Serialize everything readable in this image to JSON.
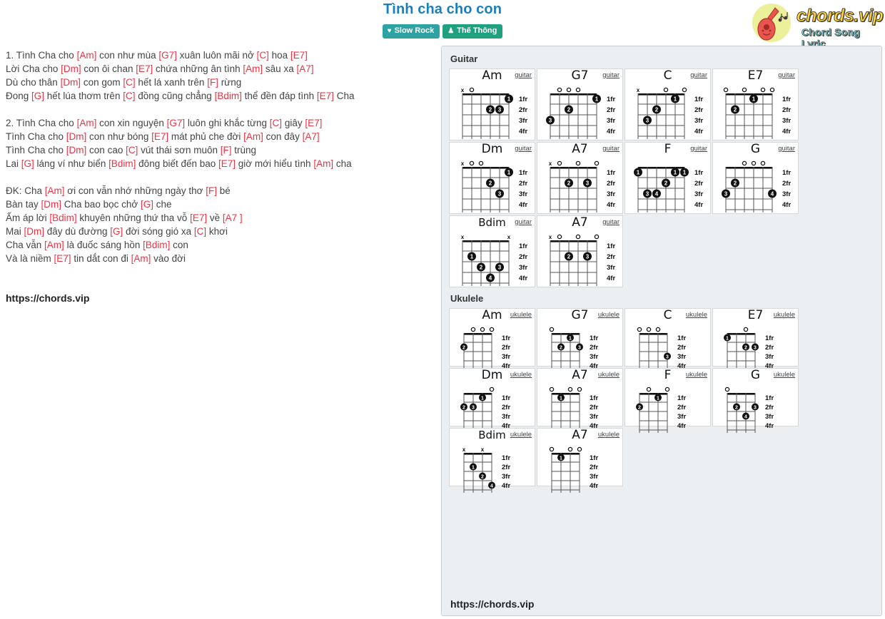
{
  "header": {
    "title": "Tình cha cho con",
    "badges": [
      {
        "name": "rhythm-badge",
        "icon": "heartbeat-icon",
        "glyph": "♥",
        "label": "Slow Rock",
        "color": "#2fa3a3"
      },
      {
        "name": "author-badge",
        "icon": "user-icon",
        "glyph": "♟",
        "label": "Thế Thông",
        "color": "#1fa07e"
      }
    ],
    "logo": {
      "brand": "chords.vip",
      "tagline": "Chord Song Lyric",
      "circle_color": "#ecf09a",
      "guitar_color": "#e8544e",
      "brand_color": "#ffd83d",
      "tagline_color": "#6fd5e3"
    }
  },
  "lyrics": {
    "chord_color": "#ee3344",
    "lines": [
      [
        {
          "t": "1. Tình Cha cho "
        },
        {
          "c": "[Am]"
        },
        {
          "t": " con như mùa "
        },
        {
          "c": "[G7]"
        },
        {
          "t": " xuân luôn mãi nở "
        },
        {
          "c": "[C]"
        },
        {
          "t": " hoa "
        },
        {
          "c": "[E7]"
        }
      ],
      [
        {
          "t": "Lời Cha cho "
        },
        {
          "c": "[Dm]"
        },
        {
          "t": " con ôi chan "
        },
        {
          "c": "[E7]"
        },
        {
          "t": " chứa những ân tình "
        },
        {
          "c": "[Am]"
        },
        {
          "t": " sâu xa "
        },
        {
          "c": "[A7]"
        }
      ],
      [
        {
          "t": "Dù cho thân "
        },
        {
          "c": "[Dm]"
        },
        {
          "t": " con gom "
        },
        {
          "c": "[C]"
        },
        {
          "t": " hết lá xanh trên "
        },
        {
          "c": "[F]"
        },
        {
          "t": " rừng"
        }
      ],
      [
        {
          "t": "Đong "
        },
        {
          "c": "[G]"
        },
        {
          "t": " hết lúa thơm trên "
        },
        {
          "c": "[C]"
        },
        {
          "t": " đồng cũng chẳng "
        },
        {
          "c": "[Bdim]"
        },
        {
          "t": " thể đền đáp tình "
        },
        {
          "c": "[E7]"
        },
        {
          "t": " Cha"
        }
      ],
      [],
      [
        {
          "t": "2. Tình Cha cho "
        },
        {
          "c": "[Am]"
        },
        {
          "t": " con xin nguyện "
        },
        {
          "c": "[G7]"
        },
        {
          "t": " luôn ghi khắc từng "
        },
        {
          "c": "[C]"
        },
        {
          "t": " giây "
        },
        {
          "c": "[E7]"
        }
      ],
      [
        {
          "t": "Tình Cha cho "
        },
        {
          "c": "[Dm]"
        },
        {
          "t": " con như bóng "
        },
        {
          "c": "[E7]"
        },
        {
          "t": " mát phủ che đời "
        },
        {
          "c": "[Am]"
        },
        {
          "t": " con đây "
        },
        {
          "c": "[A7]"
        }
      ],
      [
        {
          "t": "Tình Cha cho "
        },
        {
          "c": "[Dm]"
        },
        {
          "t": " con cao "
        },
        {
          "c": "[C]"
        },
        {
          "t": " vút thái sơn muôn "
        },
        {
          "c": "[F]"
        },
        {
          "t": " trùng"
        }
      ],
      [
        {
          "t": "Lai "
        },
        {
          "c": "[G]"
        },
        {
          "t": " láng ví như biển "
        },
        {
          "c": "[Bdim]"
        },
        {
          "t": " đông biết đến bao "
        },
        {
          "c": "[E7]"
        },
        {
          "t": " giờ mới hiểu tình "
        },
        {
          "c": "[Am]"
        },
        {
          "t": " cha"
        }
      ],
      [],
      [
        {
          "t": "ĐK: Cha "
        },
        {
          "c": "[Am]"
        },
        {
          "t": " ơi con vẫn nhớ những ngày thơ "
        },
        {
          "c": "[F]"
        },
        {
          "t": " bé"
        }
      ],
      [
        {
          "t": "Bàn tay "
        },
        {
          "c": "[Dm]"
        },
        {
          "t": " Cha bao bọc chở "
        },
        {
          "c": "[G]"
        },
        {
          "t": " che"
        }
      ],
      [
        {
          "t": "Ấm áp lời "
        },
        {
          "c": "[Bdim]"
        },
        {
          "t": " khuyên những thứ tha vỗ "
        },
        {
          "c": "[E7]"
        },
        {
          "t": " về "
        },
        {
          "c": "[A7 ]"
        }
      ],
      [
        {
          "t": "Mai "
        },
        {
          "c": "[Dm]"
        },
        {
          "t": " đây dù đường "
        },
        {
          "c": "[G]"
        },
        {
          "t": " đời sóng gió xa "
        },
        {
          "c": "[C]"
        },
        {
          "t": " khơi"
        }
      ],
      [
        {
          "t": "Cha vẫn "
        },
        {
          "c": "[Am]"
        },
        {
          "t": " là đuốc sáng hồn "
        },
        {
          "c": "[Bdim]"
        },
        {
          "t": " con"
        }
      ],
      [
        {
          "t": "Và là niềm "
        },
        {
          "c": "[E7]"
        },
        {
          "t": " tin dắt con đi "
        },
        {
          "c": "[Am]"
        },
        {
          "t": " vào đời"
        }
      ]
    ],
    "url": "https://chords.vip"
  },
  "panel": {
    "guitar_label": "Guitar",
    "ukulele_label": "Ukulele",
    "fret_labels": [
      "1fr",
      "2fr",
      "3fr",
      "4fr"
    ],
    "instrument_guitar": "guitar",
    "instrument_ukulele": "ukulele",
    "url": "https://chords.vip",
    "guitar_chords": [
      {
        "name": "Am",
        "open": [
          "x",
          "o",
          "",
          "",
          "",
          ""
        ],
        "dots": [
          {
            "s": 5,
            "f": 1,
            "n": "1"
          },
          {
            "s": 3,
            "f": 2,
            "n": "2"
          },
          {
            "s": 4,
            "f": 2,
            "n": "3"
          }
        ]
      },
      {
        "name": "G7",
        "open": [
          "",
          "o",
          "o",
          "o",
          ""
        ],
        "dots": [
          {
            "s": 5,
            "f": 1,
            "n": "1"
          },
          {
            "s": 2,
            "f": 2,
            "n": "2"
          },
          {
            "s": 0,
            "f": 3,
            "n": "3"
          }
        ]
      },
      {
        "name": "C",
        "open": [
          "x",
          "",
          "",
          "o",
          "",
          "o"
        ],
        "dots": [
          {
            "s": 4,
            "f": 1,
            "n": "1"
          },
          {
            "s": 2,
            "f": 2,
            "n": "2"
          },
          {
            "s": 1,
            "f": 3,
            "n": "3"
          }
        ]
      },
      {
        "name": "E7",
        "open": [
          "o",
          "",
          "o",
          "",
          "o",
          "o"
        ],
        "dots": [
          {
            "s": 3,
            "f": 1,
            "n": "1"
          },
          {
            "s": 1,
            "f": 2,
            "n": "2"
          }
        ]
      },
      {
        "name": "Dm",
        "open": [
          "x",
          "o",
          "o",
          "",
          "",
          ""
        ],
        "dots": [
          {
            "s": 5,
            "f": 1,
            "n": "1"
          },
          {
            "s": 3,
            "f": 2,
            "n": "2"
          },
          {
            "s": 4,
            "f": 3,
            "n": "3"
          }
        ]
      },
      {
        "name": "A7",
        "open": [
          "x",
          "o",
          "",
          "o",
          "",
          "o"
        ],
        "dots": [
          {
            "s": 2,
            "f": 2,
            "n": "2"
          },
          {
            "s": 4,
            "f": 2,
            "n": "3"
          }
        ]
      },
      {
        "name": "F",
        "open": [
          "",
          "",
          "",
          "",
          "",
          ""
        ],
        "dots": [
          {
            "s": 0,
            "f": 1,
            "n": "1"
          },
          {
            "s": 4,
            "f": 1,
            "n": "1"
          },
          {
            "s": 5,
            "f": 1,
            "n": "1"
          },
          {
            "s": 3,
            "f": 2,
            "n": "2"
          },
          {
            "s": 1,
            "f": 3,
            "n": "3"
          },
          {
            "s": 2,
            "f": 3,
            "n": "4"
          }
        ]
      },
      {
        "name": "G",
        "open": [
          "",
          "",
          "o",
          "o",
          "o",
          ""
        ],
        "dots": [
          {
            "s": 1,
            "f": 2,
            "n": "2"
          },
          {
            "s": 0,
            "f": 3,
            "n": "3"
          },
          {
            "s": 5,
            "f": 3,
            "n": "4"
          }
        ]
      },
      {
        "name": "Bdim",
        "open": [
          "x",
          "",
          "",
          "",
          "",
          "x"
        ],
        "dots": [
          {
            "s": 1,
            "f": 2,
            "n": "1"
          },
          {
            "s": 2,
            "f": 3,
            "n": "2"
          },
          {
            "s": 4,
            "f": 3,
            "n": "3"
          },
          {
            "s": 3,
            "f": 4,
            "n": "4"
          }
        ]
      },
      {
        "name": "A7",
        "open": [
          "x",
          "o",
          "",
          "o",
          "",
          "o"
        ],
        "dots": [
          {
            "s": 2,
            "f": 2,
            "n": "2"
          },
          {
            "s": 4,
            "f": 2,
            "n": "3"
          }
        ]
      }
    ],
    "ukulele_chords": [
      {
        "name": "Am",
        "open": [
          "",
          "o",
          "o",
          "o"
        ],
        "dots": [
          {
            "s": 0,
            "f": 2,
            "n": "2"
          }
        ]
      },
      {
        "name": "G7",
        "open": [
          "o",
          "",
          "",
          ""
        ],
        "dots": [
          {
            "s": 2,
            "f": 1,
            "n": "1"
          },
          {
            "s": 1,
            "f": 2,
            "n": "2"
          },
          {
            "s": 3,
            "f": 2,
            "n": "3"
          }
        ]
      },
      {
        "name": "C",
        "open": [
          "o",
          "o",
          "o",
          ""
        ],
        "dots": [
          {
            "s": 3,
            "f": 3,
            "n": "3"
          }
        ]
      },
      {
        "name": "E7",
        "open": [
          "",
          "",
          "o",
          ""
        ],
        "dots": [
          {
            "s": 0,
            "f": 1,
            "n": "1"
          },
          {
            "s": 2,
            "f": 2,
            "n": "2"
          },
          {
            "s": 3,
            "f": 2,
            "n": "3"
          }
        ]
      },
      {
        "name": "Dm",
        "open": [
          "",
          "",
          "",
          "o"
        ],
        "dots": [
          {
            "s": 2,
            "f": 1,
            "n": "1"
          },
          {
            "s": 0,
            "f": 2,
            "n": "2"
          },
          {
            "s": 1,
            "f": 2,
            "n": "3"
          }
        ]
      },
      {
        "name": "A7",
        "open": [
          "o",
          "",
          "o",
          "o"
        ],
        "dots": [
          {
            "s": 1,
            "f": 1,
            "n": "1"
          }
        ]
      },
      {
        "name": "F",
        "open": [
          "",
          "o",
          "",
          "o"
        ],
        "dots": [
          {
            "s": 2,
            "f": 1,
            "n": "1"
          },
          {
            "s": 0,
            "f": 2,
            "n": "2"
          }
        ]
      },
      {
        "name": "G",
        "open": [
          "o",
          "",
          "",
          ""
        ],
        "dots": [
          {
            "s": 1,
            "f": 2,
            "n": "2"
          },
          {
            "s": 3,
            "f": 2,
            "n": "3"
          },
          {
            "s": 2,
            "f": 3,
            "n": "4"
          }
        ]
      },
      {
        "name": "Bdim",
        "open": [
          "x",
          "",
          "x",
          ""
        ],
        "dots": [
          {
            "s": 1,
            "f": 2,
            "n": "1"
          },
          {
            "s": 2,
            "f": 3,
            "n": "2"
          },
          {
            "s": 4,
            "f": 3,
            "n": "3"
          },
          {
            "s": 3,
            "f": 4,
            "n": "4"
          }
        ]
      },
      {
        "name": "A7",
        "open": [
          "o",
          "",
          "o",
          "o"
        ],
        "dots": [
          {
            "s": 1,
            "f": 1,
            "n": "1"
          }
        ]
      }
    ]
  }
}
